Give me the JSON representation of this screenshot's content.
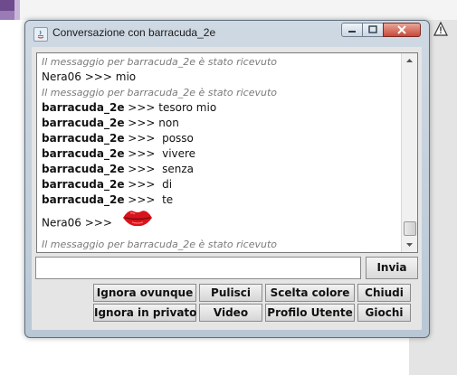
{
  "window": {
    "title": "Conversazione con barracuda_2e"
  },
  "chat": {
    "lines": [
      {
        "type": "system",
        "text": "Il messaggio per barracuda_2e è stato ricevuto"
      },
      {
        "type": "msg",
        "sender": "Nera06",
        "separator": ">>>",
        "text": "mio"
      },
      {
        "type": "system",
        "text": "Il messaggio per barracuda_2e è stato ricevuto"
      },
      {
        "type": "msg",
        "sender": "barracuda_2e",
        "separator": ">>>",
        "text": "tesoro mio"
      },
      {
        "type": "msg",
        "sender": "barracuda_2e",
        "separator": ">>>",
        "text": "non"
      },
      {
        "type": "msg",
        "sender": "barracuda_2e",
        "separator": ">>>",
        "text": " posso"
      },
      {
        "type": "msg",
        "sender": "barracuda_2e",
        "separator": ">>>",
        "text": " vivere"
      },
      {
        "type": "msg",
        "sender": "barracuda_2e",
        "separator": ">>>",
        "text": " senza"
      },
      {
        "type": "msg",
        "sender": "barracuda_2e",
        "separator": ">>>",
        "text": " di"
      },
      {
        "type": "msg",
        "sender": "barracuda_2e",
        "separator": ">>>",
        "text": " te"
      },
      {
        "type": "emoticon",
        "sender": "Nera06",
        "separator": ">>>",
        "icon": "lips-icon"
      },
      {
        "type": "system",
        "text": "Il messaggio per barracuda_2e è stato ricevuto"
      }
    ]
  },
  "compose": {
    "value": "",
    "send_label": "Invia"
  },
  "buttons": {
    "ignore_everywhere": "Ignora ovunque",
    "clear": "Pulisci",
    "choose_color": "Scelta colore",
    "close": "Chiudi",
    "ignore_private": "Ignora in privato",
    "video": "Video",
    "user_profile": "Profilo Utente",
    "games": "Giochi"
  },
  "colors": {
    "system_text": "#7a7a7a",
    "lips": "#d8141c"
  }
}
